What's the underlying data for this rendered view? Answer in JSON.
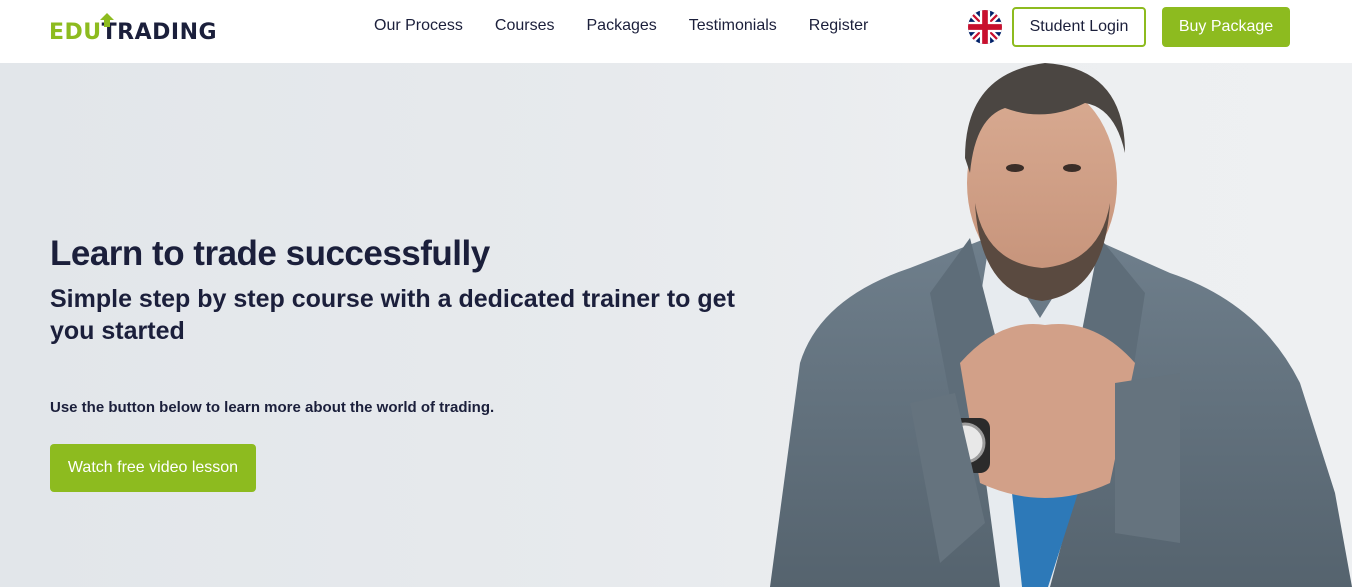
{
  "header": {
    "logo": {
      "part1": "EDU",
      "part2": "TRADING"
    },
    "nav": [
      {
        "label": "Our Process"
      },
      {
        "label": "Courses"
      },
      {
        "label": "Packages"
      },
      {
        "label": "Testimonials"
      },
      {
        "label": "Register"
      }
    ],
    "language_icon": "uk-flag-icon",
    "student_login_label": "Student Login",
    "buy_package_label": "Buy Package"
  },
  "hero": {
    "title": "Learn to trade successfully",
    "subtitle": "Simple step by step course with a dedicated trainer to get you started",
    "text": "Use the button below to learn more about the world of trading.",
    "cta_label": "Watch free video lesson"
  },
  "colors": {
    "accent": "#8dbb1f",
    "text_dark": "#1b1f3b",
    "hero_bg": "#e5e8eb"
  }
}
